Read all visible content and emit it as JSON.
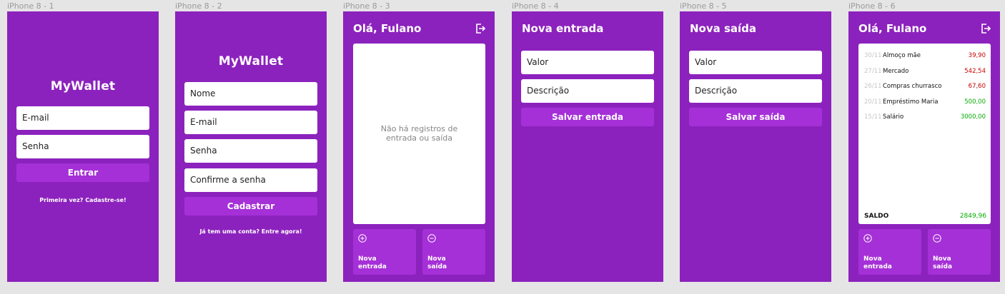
{
  "frames": [
    {
      "label": "iPhone 8 - 1"
    },
    {
      "label": "iPhone 8 - 2"
    },
    {
      "label": "iPhone 8 - 3"
    },
    {
      "label": "iPhone 8 - 4"
    },
    {
      "label": "iPhone 8 - 5"
    },
    {
      "label": "iPhone 8 - 6"
    }
  ],
  "login": {
    "logo": "MyWallet",
    "email_placeholder": "E-mail",
    "password_placeholder": "Senha",
    "submit": "Entrar",
    "signup_link": "Primeira vez? Cadastre-se!"
  },
  "signup": {
    "logo": "MyWallet",
    "name_placeholder": "Nome",
    "email_placeholder": "E-mail",
    "password_placeholder": "Senha",
    "confirm_placeholder": "Confirme a senha",
    "submit": "Cadastrar",
    "login_link": "Já tem uma conta? Entre agora!"
  },
  "home_empty": {
    "greeting": "Olá, Fulano",
    "empty_message": "Não há registros de\nentrada ou saída",
    "new_income": "Nova\nentrada",
    "new_expense": "Nova\nsaída"
  },
  "new_income": {
    "title": "Nova entrada",
    "value_placeholder": "Valor",
    "description_placeholder": "Descrição",
    "submit": "Salvar entrada"
  },
  "new_expense": {
    "title": "Nova saída",
    "value_placeholder": "Valor",
    "description_placeholder": "Descrição",
    "submit": "Salvar saída"
  },
  "home_filled": {
    "greeting": "Olá, Fulano",
    "transactions": [
      {
        "date": "30/11",
        "description": "Almoço mãe",
        "value": "39,90",
        "type": "expense"
      },
      {
        "date": "27/11",
        "description": "Mercado",
        "value": "542,54",
        "type": "expense"
      },
      {
        "date": "26/11",
        "description": "Compras churrasco",
        "value": "67,60",
        "type": "expense"
      },
      {
        "date": "20/11",
        "description": "Empréstimo Maria",
        "value": "500,00",
        "type": "income"
      },
      {
        "date": "15/11",
        "description": "Salário",
        "value": "3000,00",
        "type": "income"
      }
    ],
    "balance_label": "SALDO",
    "balance_value": "2849,96",
    "new_income": "Nova\nentrada",
    "new_expense": "Nova\nsaída"
  },
  "colors": {
    "background": "#8c22bd",
    "button": "#a530d7",
    "income": "#03ac00",
    "expense": "#c70000"
  }
}
